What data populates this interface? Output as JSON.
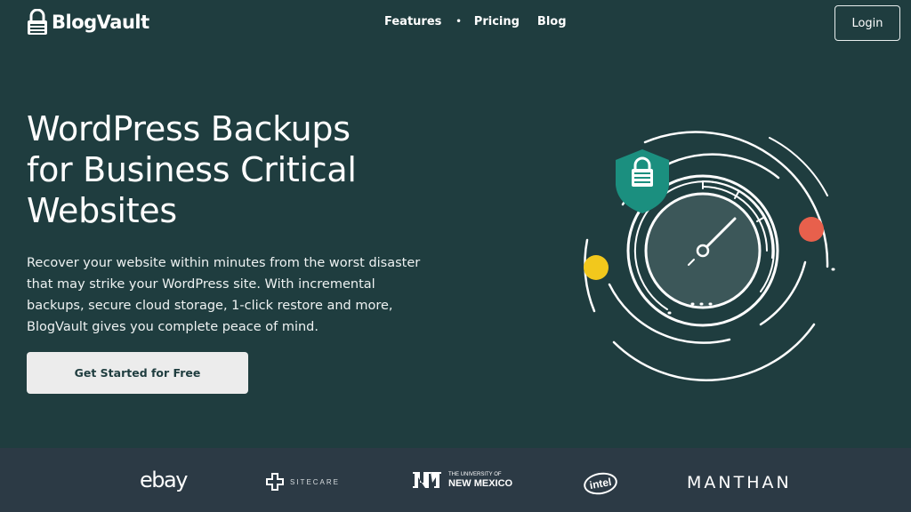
{
  "header": {
    "logo_text": "BlogVault",
    "nav": [
      {
        "label": "Features"
      },
      {
        "label": "Pricing"
      },
      {
        "label": "Blog"
      }
    ],
    "login_label": "Login"
  },
  "hero": {
    "title_lines": [
      "WordPress Backups",
      "for Business Critical",
      "Websites"
    ],
    "description_lines": [
      "Recover your website within minutes from the worst disaster",
      "that may strike your WordPress site. With incremental",
      "backups, secure cloud storage, 1-click restore and more,",
      "BlogVault gives you complete peace of mind."
    ],
    "cta_label": "Get Started for Free"
  },
  "logos": {
    "ebay": "ebay",
    "sitecare": "SITECARE",
    "unm_small": "THE UNIVERSITY OF",
    "unm_big": "NEW MEXICO",
    "intel": "intel",
    "manthan": "MANTHAN"
  },
  "colors": {
    "background": "#1f3d3f",
    "shield": "#1b8f7f",
    "accent_red": "#e8604c",
    "accent_yellow": "#f2c81c",
    "logo_bar": "#2c3a45"
  }
}
